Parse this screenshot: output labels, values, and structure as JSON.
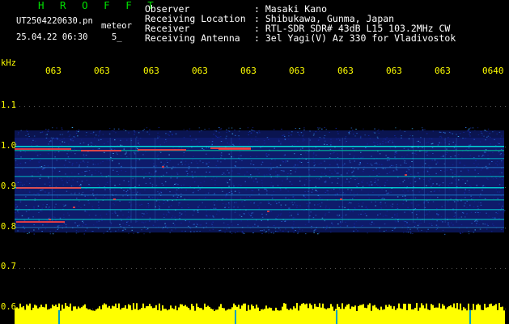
{
  "header": {
    "brand": "H R O F F T",
    "filename": "UT2504220630.pn",
    "meteor_label": "meteor",
    "datetime": "25.04.22 06:30",
    "count": "5_"
  },
  "info": [
    {
      "label": "Observer",
      "value": ": Masaki Kano"
    },
    {
      "label": "Receiving Location",
      "value": ": Shibukawa, Gunma, Japan"
    },
    {
      "label": "Receiver",
      "value": ": RTL-SDR SDR# 43dB L15 103.2MHz CW"
    },
    {
      "label": "Receiving Antenna",
      "value": ": 3el Yagi(V) Az 330 for Vladivostok"
    }
  ],
  "axis": {
    "unit": "kHz",
    "time_ticks": [
      "063",
      "063",
      "063",
      "063",
      "063",
      "063",
      "063",
      "063",
      "063",
      "0640"
    ],
    "freq_ticks": [
      "1.1",
      "1.0",
      "0.9",
      "0.8",
      "0.7",
      "0.6"
    ]
  },
  "colors": {
    "axis_text": "#ffff00",
    "brand_text": "#00e000",
    "background": "#000000",
    "noise_low": "#1428a0",
    "noise_mid": "#2a6cd6",
    "signal": "#00d8d8",
    "echo_hot": "#ff4040",
    "power_bar": "#ffff00"
  }
}
